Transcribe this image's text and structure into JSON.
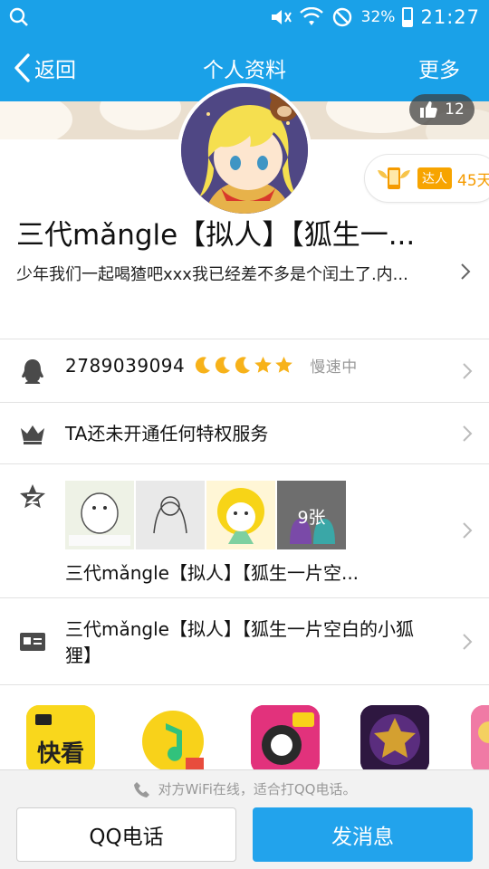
{
  "status_bar": {
    "battery": "32%",
    "time": "21:27",
    "icons": [
      "search-icon",
      "mute-icon",
      "wifi-icon",
      "no-disturb-icon",
      "battery-icon"
    ]
  },
  "nav": {
    "back_label": "返回",
    "title": "个人资料",
    "more_label": "更多"
  },
  "profile": {
    "likes": "12",
    "daren_tag": "达人",
    "daren_days": "45天",
    "nickname": "三代mǎngle【拟人】【狐生一...",
    "signature": "少年我们一起喝猹吧xxx我已经差不多是个闰土了.内..."
  },
  "rows": {
    "qq_number": "2789039094",
    "speed_status": "慢速中",
    "vip_text": "TA还未开通任何特权服务",
    "zone_photo_count": "9张",
    "zone_caption": "三代mǎngle【拟人】【狐生一片空...",
    "card_text": "三代mǎngle【拟人】【狐生一片空白的小狐狸】"
  },
  "apps": [
    "kuaikan-app-icon",
    "qq-music-app-icon",
    "rhythm-game-app-icon",
    "star-app-icon",
    "partial-app-icon"
  ],
  "bottom": {
    "hint": "对方WiFi在线，适合打QQ电话。",
    "call_label": "QQ电话",
    "message_label": "发消息"
  },
  "colors": {
    "brand_blue": "#1aa1e8",
    "button_blue": "#22a3ec",
    "daren_orange": "#f59b00"
  }
}
